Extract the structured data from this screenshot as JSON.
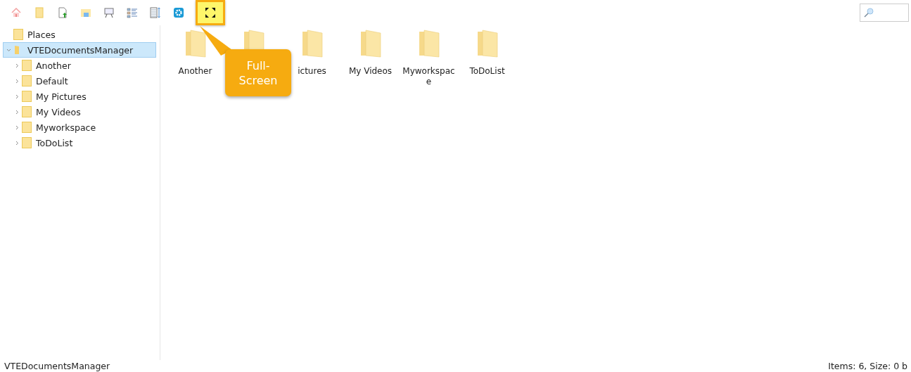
{
  "toolbar": {
    "buttons": [
      {
        "kind": "home",
        "selected": false
      },
      {
        "kind": "folder",
        "selected": false
      },
      {
        "kind": "upload",
        "selected": false
      },
      {
        "kind": "explorer",
        "selected": false
      },
      {
        "kind": "presentation",
        "selected": false
      },
      {
        "kind": "details",
        "selected": false
      },
      {
        "kind": "columns",
        "selected": false
      },
      {
        "kind": "settings",
        "selected": false
      },
      {
        "kind": "fullscreen",
        "selected": true
      }
    ],
    "tooltip": "Full-Screen"
  },
  "sidebar": {
    "items": [
      {
        "label": "Places",
        "selected": false
      },
      {
        "label": "VTEDocumentsManager",
        "selected": true,
        "expanded": true,
        "children": [
          {
            "label": "Another",
            "selected": false,
            "expanded": false
          },
          {
            "label": "Default",
            "selected": false,
            "expanded": false
          },
          {
            "label": "My Pictures",
            "selected": false,
            "expanded": false
          },
          {
            "label": "My Videos",
            "selected": false,
            "expanded": false
          },
          {
            "label": "Myworkspace",
            "selected": false,
            "expanded": false
          },
          {
            "label": "ToDoList",
            "selected": false,
            "expanded": false
          }
        ]
      }
    ]
  },
  "grid": {
    "items": [
      {
        "kind": "folder",
        "label": "Another"
      },
      {
        "kind": "folder"
      },
      {
        "kind": "folder",
        "label": "ictures"
      },
      {
        "kind": "folder",
        "label": "My Videos"
      },
      {
        "kind": "folder",
        "label": "Myworkspace"
      },
      {
        "kind": "folder",
        "label": "ToDoList"
      }
    ]
  },
  "status_bar": {
    "path": "VTEDocumentsManager",
    "summary": "Items: 6, Size: 0 b"
  }
}
